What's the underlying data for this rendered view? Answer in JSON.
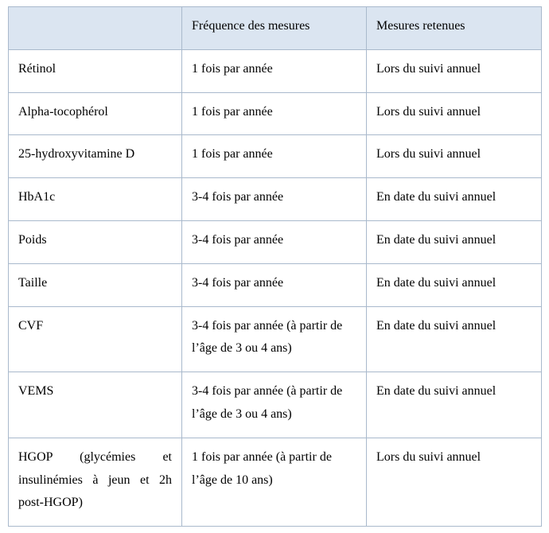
{
  "table": {
    "headers": {
      "col0": "",
      "col1": "Fréquence des mesures",
      "col2": "Mesures retenues"
    },
    "rows": [
      {
        "param": "Rétinol",
        "freq": "1 fois par année",
        "ret": "Lors du suivi annuel"
      },
      {
        "param": "Alpha-tocophérol",
        "freq": "1 fois par année",
        "ret": "Lors du suivi annuel"
      },
      {
        "param": "25-hydroxyvitamine D",
        "freq": "1 fois par année",
        "ret": "Lors du suivi annuel"
      },
      {
        "param": "HbA1c",
        "freq": "3-4 fois par année",
        "ret": "En date du suivi annuel"
      },
      {
        "param": "Poids",
        "freq": "3-4 fois par année",
        "ret": "En date du suivi annuel"
      },
      {
        "param": "Taille",
        "freq": "3-4 fois par année",
        "ret": "En date du suivi annuel"
      },
      {
        "param": "CVF",
        "freq": "3-4 fois par année (à partir de l’âge de 3 ou 4 ans)",
        "ret": "En date du suivi annuel"
      },
      {
        "param": "VEMS",
        "freq": "3-4 fois par année (à partir de l’âge de 3 ou 4 ans)",
        "ret": "En date du suivi annuel"
      },
      {
        "param": "HGOP (glycémies et insulinémies à jeun et 2h post-HGOP)",
        "freq": "1 fois par année (à partir de l’âge de 10 ans)",
        "ret": "Lors du suivi annuel"
      }
    ]
  }
}
